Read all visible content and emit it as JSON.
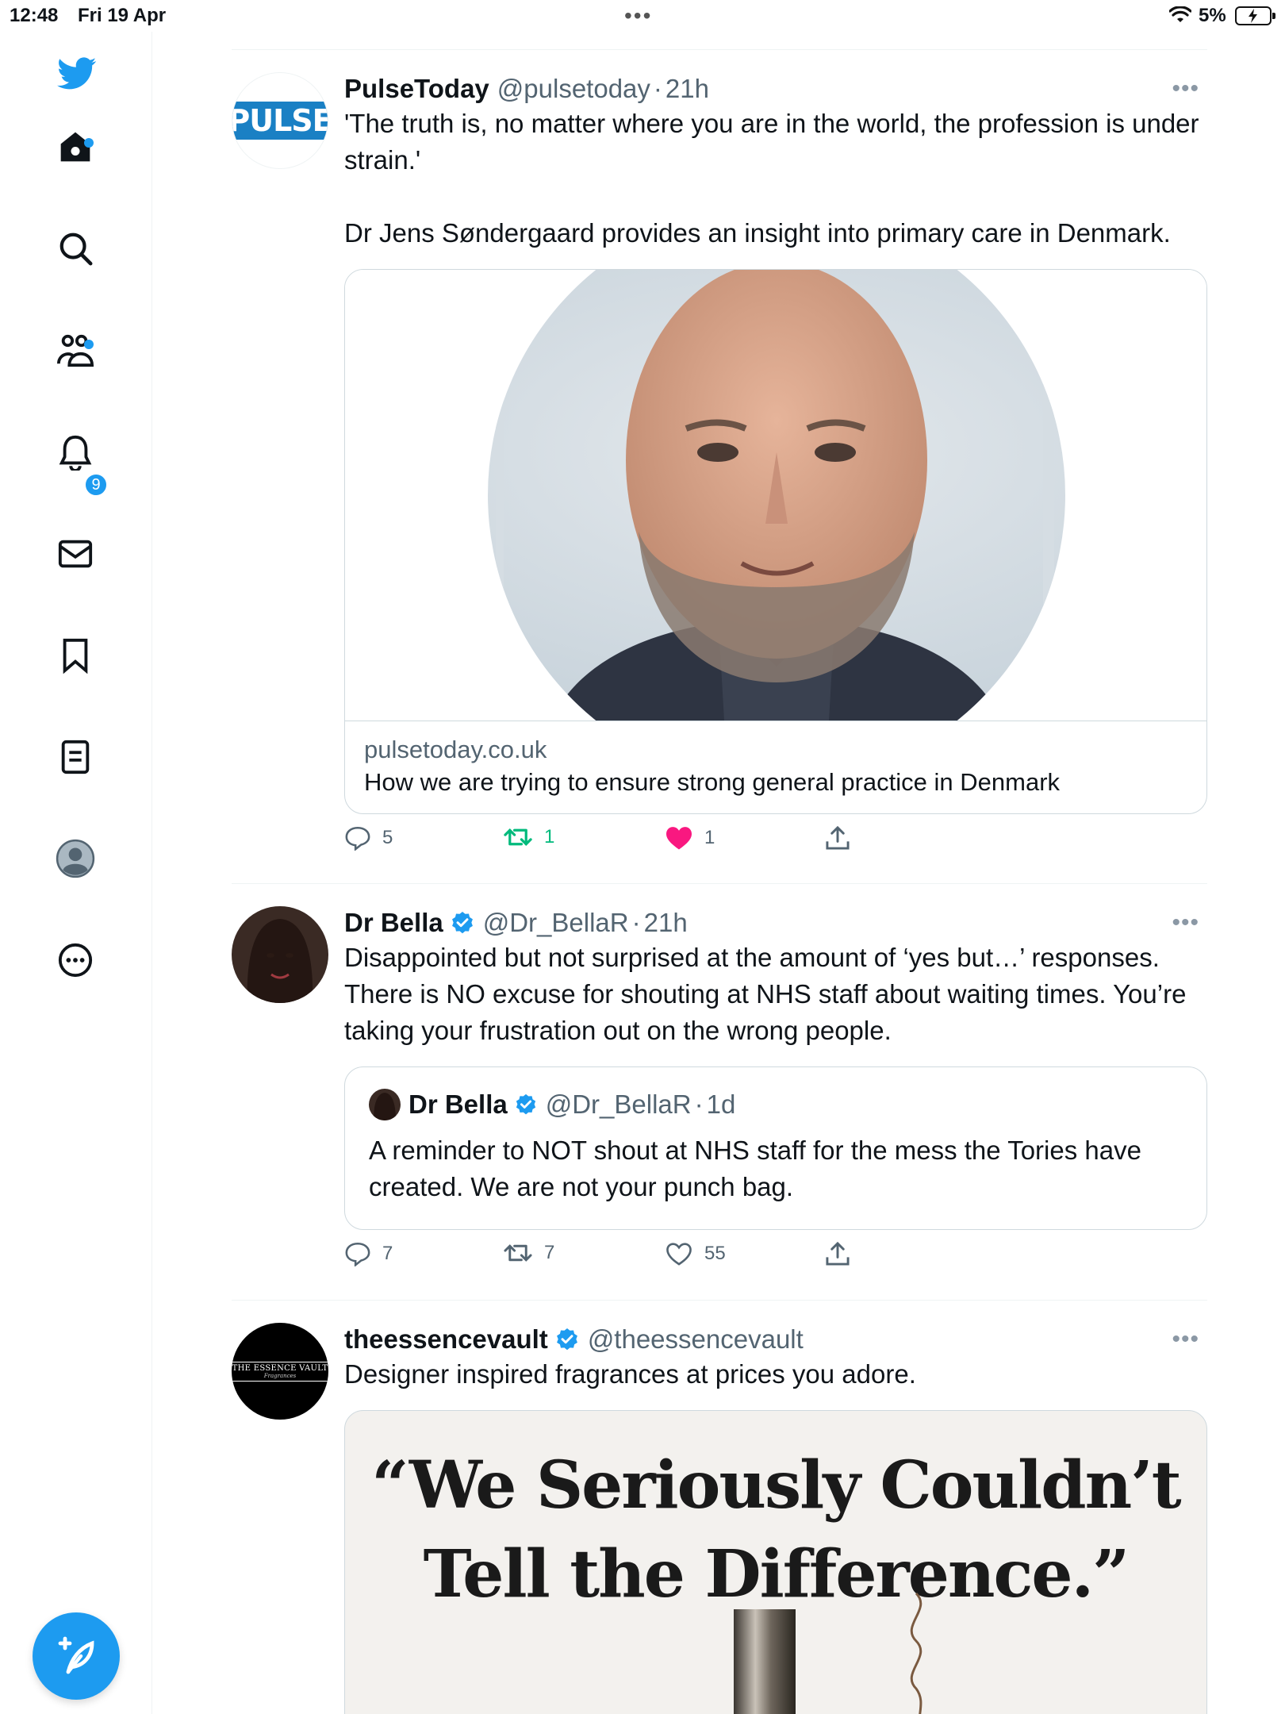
{
  "status_bar": {
    "time": "12:48",
    "date": "Fri 19 Apr",
    "battery": "5%"
  },
  "sidebar": {
    "notifications_badge": "9",
    "items": [
      {
        "name": "home"
      },
      {
        "name": "explore"
      },
      {
        "name": "communities"
      },
      {
        "name": "notifications"
      },
      {
        "name": "messages"
      },
      {
        "name": "bookmarks"
      },
      {
        "name": "lists"
      },
      {
        "name": "profile"
      },
      {
        "name": "more"
      }
    ]
  },
  "tweets": [
    {
      "name": "PulseToday",
      "handle": "@pulsetoday",
      "time": "21h",
      "avatar_text": "PULSE",
      "text": "'The truth is, no matter where you are in the world, the profession is under strain.'\n\nDr Jens Søndergaard provides an insight into primary care in Denmark.",
      "card": {
        "domain": "pulsetoday.co.uk",
        "title": "How we are trying to ensure strong general practice in Denmark"
      },
      "replies": "5",
      "retweets": "1",
      "likes": "1"
    },
    {
      "name": "Dr Bella",
      "handle": "@Dr_BellaR",
      "time": "21h",
      "text": "Disappointed but not surprised at the amount of ‘yes but…’ responses. There is NO excuse for shouting at NHS staff about waiting times. You’re taking your frustration out on the wrong people.",
      "quote": {
        "name": "Dr Bella",
        "handle": "@Dr_BellaR",
        "time": "1d",
        "text": "A reminder to NOT shout at NHS staff for the mess the Tories have created. We are not your punch bag."
      },
      "replies": "7",
      "retweets": "7",
      "likes": "55"
    },
    {
      "name": "theessencevault",
      "handle": "@theessencevault",
      "avatar_text": "THE ESSENCE VAULT",
      "avatar_subtext": "Fragrances",
      "text": "Designer inspired fragrances at prices you adore.",
      "ad_image_text": "“We Seriously Couldn’t Tell the Difference.”"
    }
  ],
  "colors": {
    "accent": "#1d9bf0",
    "retweet_active": "#00ba7c",
    "like_active": "#f91880"
  }
}
